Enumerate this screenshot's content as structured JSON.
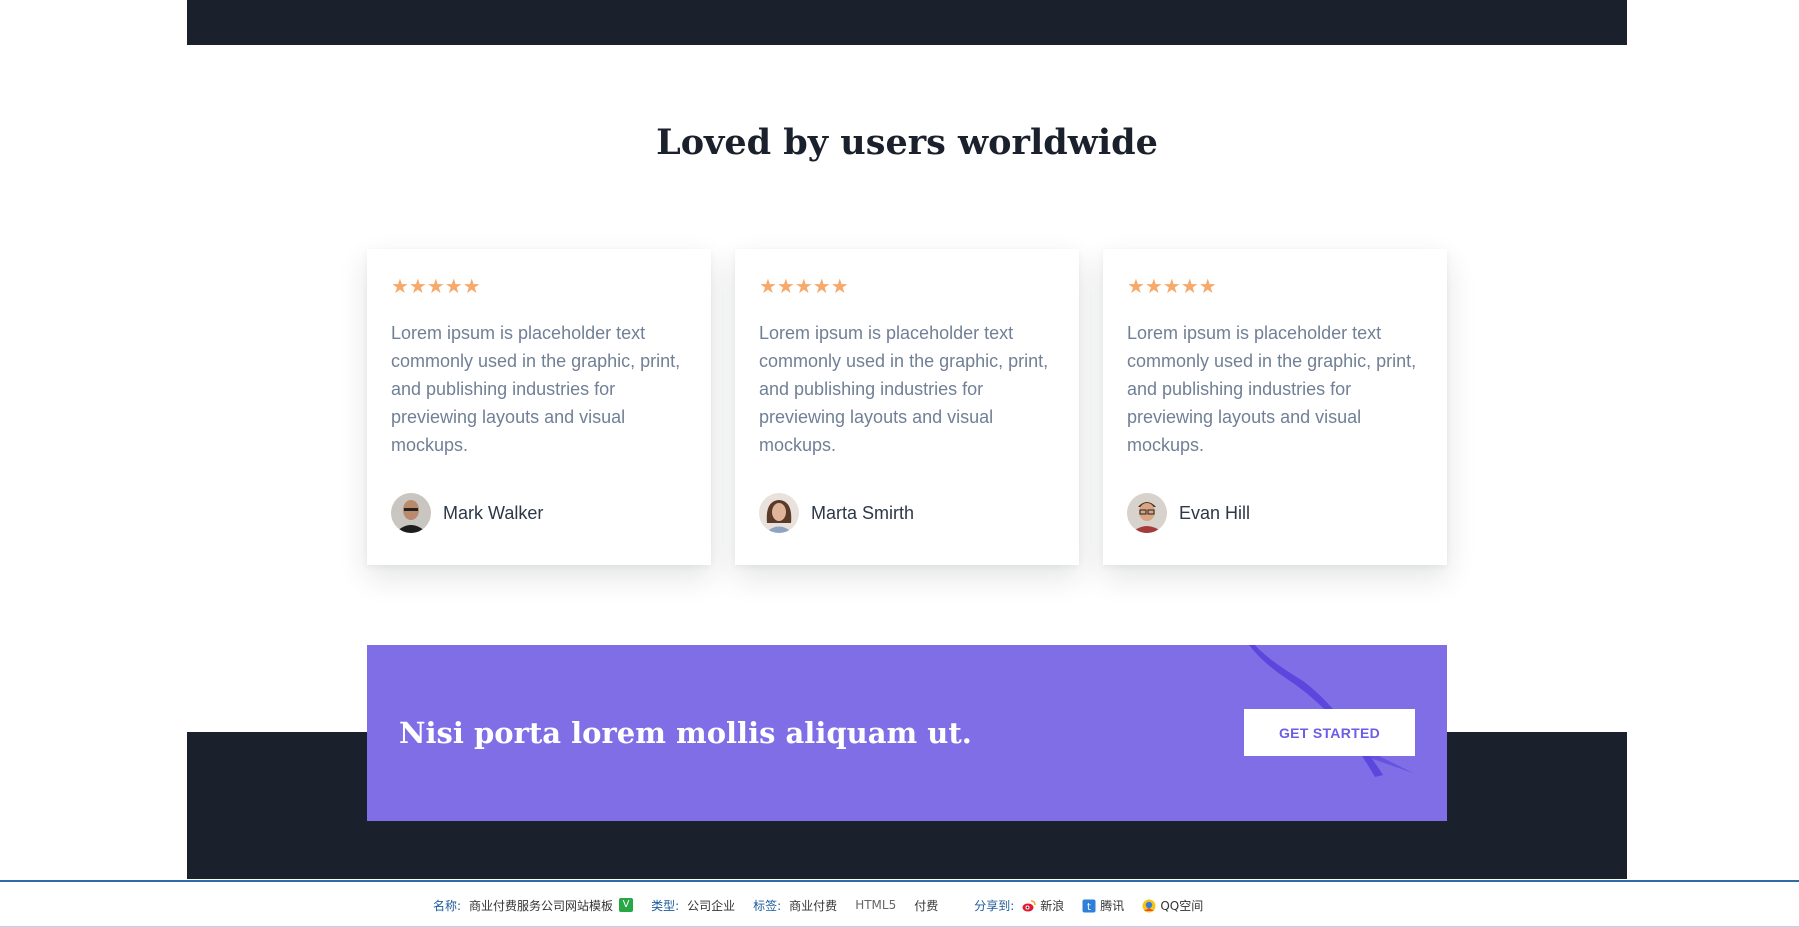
{
  "section": {
    "heading": "Loved by users worldwide"
  },
  "testimonials": [
    {
      "stars": "★★★★★",
      "quote": "Lorem ipsum is placeholder text commonly used in the graphic, print, and publishing industries for previewing layouts and visual mockups.",
      "name": "Mark Walker"
    },
    {
      "stars": "★★★★★",
      "quote": "Lorem ipsum is placeholder text commonly used in the graphic, print, and publishing industries for previewing layouts and visual mockups.",
      "name": "Marta Smirth"
    },
    {
      "stars": "★★★★★",
      "quote": "Lorem ipsum is placeholder text commonly used in the graphic, print, and publishing industries for previewing layouts and visual mockups.",
      "name": "Evan Hill"
    }
  ],
  "cta": {
    "text": "Nisi porta lorem mollis aliquam ut.",
    "button_label": "GET STARTED"
  },
  "footer_bar": {
    "name_label": "名称:",
    "name_value": "商业付费服务公司网站模板",
    "verified_badge": "V",
    "type_label": "类型:",
    "type_value": "公司企业",
    "tags_label": "标签:",
    "tags": [
      "商业付费",
      "HTML5",
      "付费"
    ],
    "share_label": "分享到:",
    "share_targets": [
      "新浪",
      "腾讯",
      "QQ空间"
    ]
  },
  "colors": {
    "dark_band": "#1a202c",
    "star": "#f6a96b",
    "cta_bg": "#7f6ee6",
    "cta_button_text": "#6c5ce7"
  },
  "icons": [
    "star-icon",
    "avatar-icon",
    "weibo-icon",
    "tencent-icon",
    "qzone-icon"
  ]
}
